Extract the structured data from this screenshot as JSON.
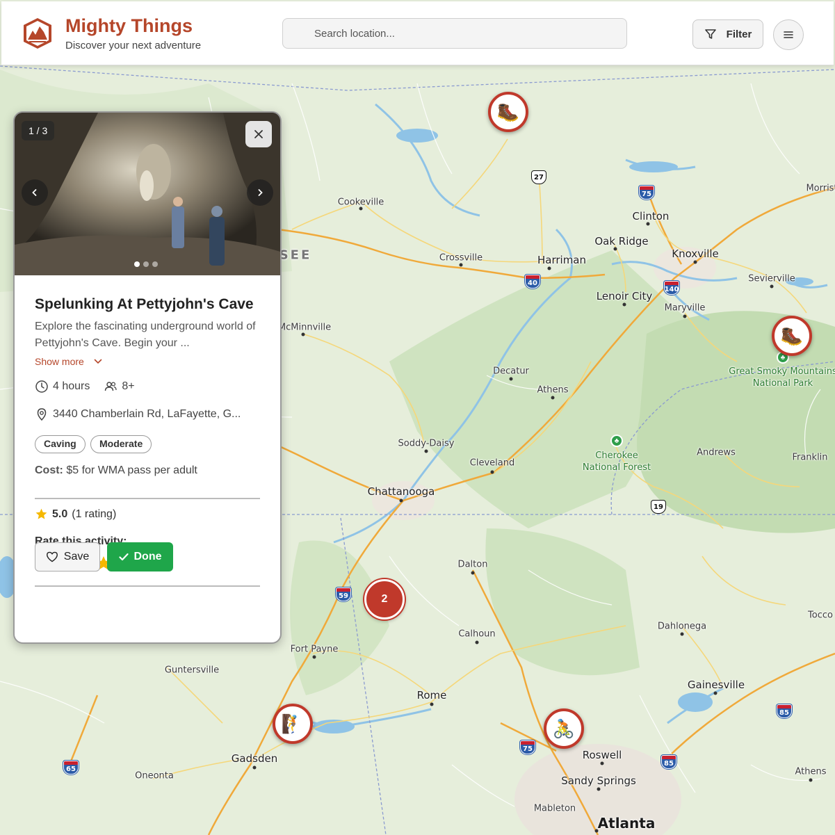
{
  "header": {
    "brand_title": "Mighty Things",
    "brand_subtitle": "Discover your next adventure",
    "search_placeholder": "Search location...",
    "filter_label": "Filter",
    "accent_color": "#b5462a"
  },
  "card": {
    "photo_counter": "1 / 3",
    "photo_count": 3,
    "active_photo": 1,
    "title": "Spelunking At Pettyjohn's Cave",
    "description": "Explore the fascinating underground world of Pettyjohn's Cave. Begin your ...",
    "show_more": "Show more",
    "duration": "4 hours",
    "group_size": "8+",
    "address": "3440 Chamberlain Rd, LaFayette, G...",
    "tags": [
      "Caving",
      "Moderate"
    ],
    "cost_label": "Cost:",
    "cost_value": "$5 for WMA pass per adult",
    "rating_value": "5.0",
    "rating_count": "(1 rating)",
    "rate_label": "Rate this activity:",
    "stars_filled": 5,
    "save_label": "Save",
    "done_label": "Done",
    "done_color": "#1fa64a"
  },
  "map": {
    "marker_color": "#c0392b",
    "cluster_count": "2",
    "markers": [
      {
        "icon": "hiking-boot-icon",
        "glyph": "🥾"
      },
      {
        "icon": "hiking-boot-icon",
        "glyph": "🥾"
      },
      {
        "icon": "climbing-icon",
        "glyph": "🧗"
      },
      {
        "icon": "cycling-icon",
        "glyph": "🚴"
      }
    ],
    "cities": [
      "Cookeville",
      "Crossville",
      "Harriman",
      "Clinton",
      "Oak Ridge",
      "Knoxville",
      "Morrist",
      "Sevierville",
      "Lenoir City",
      "Maryville",
      "McMinnville",
      "Decatur",
      "Athens",
      "Soddy-Daisy",
      "Cleveland",
      "Chattanooga",
      "Andrews",
      "Franklin",
      "Dalton",
      "Calhoun",
      "Fort Payne",
      "Guntersville",
      "Dahlonega",
      "Tocco",
      "Gainesville",
      "Rome",
      "Gadsden",
      "Roswell",
      "Sandy Springs",
      "Athens",
      "Oneonta",
      "Mableton",
      "Atlanta"
    ],
    "state_label": "SEE",
    "parks": [
      "Great Smoky Mountains\nNational Park",
      "Cherokee\nNational Forest"
    ],
    "shields": [
      "27",
      "75",
      "40",
      "140",
      "59",
      "19",
      "75",
      "85",
      "85",
      "65"
    ]
  }
}
